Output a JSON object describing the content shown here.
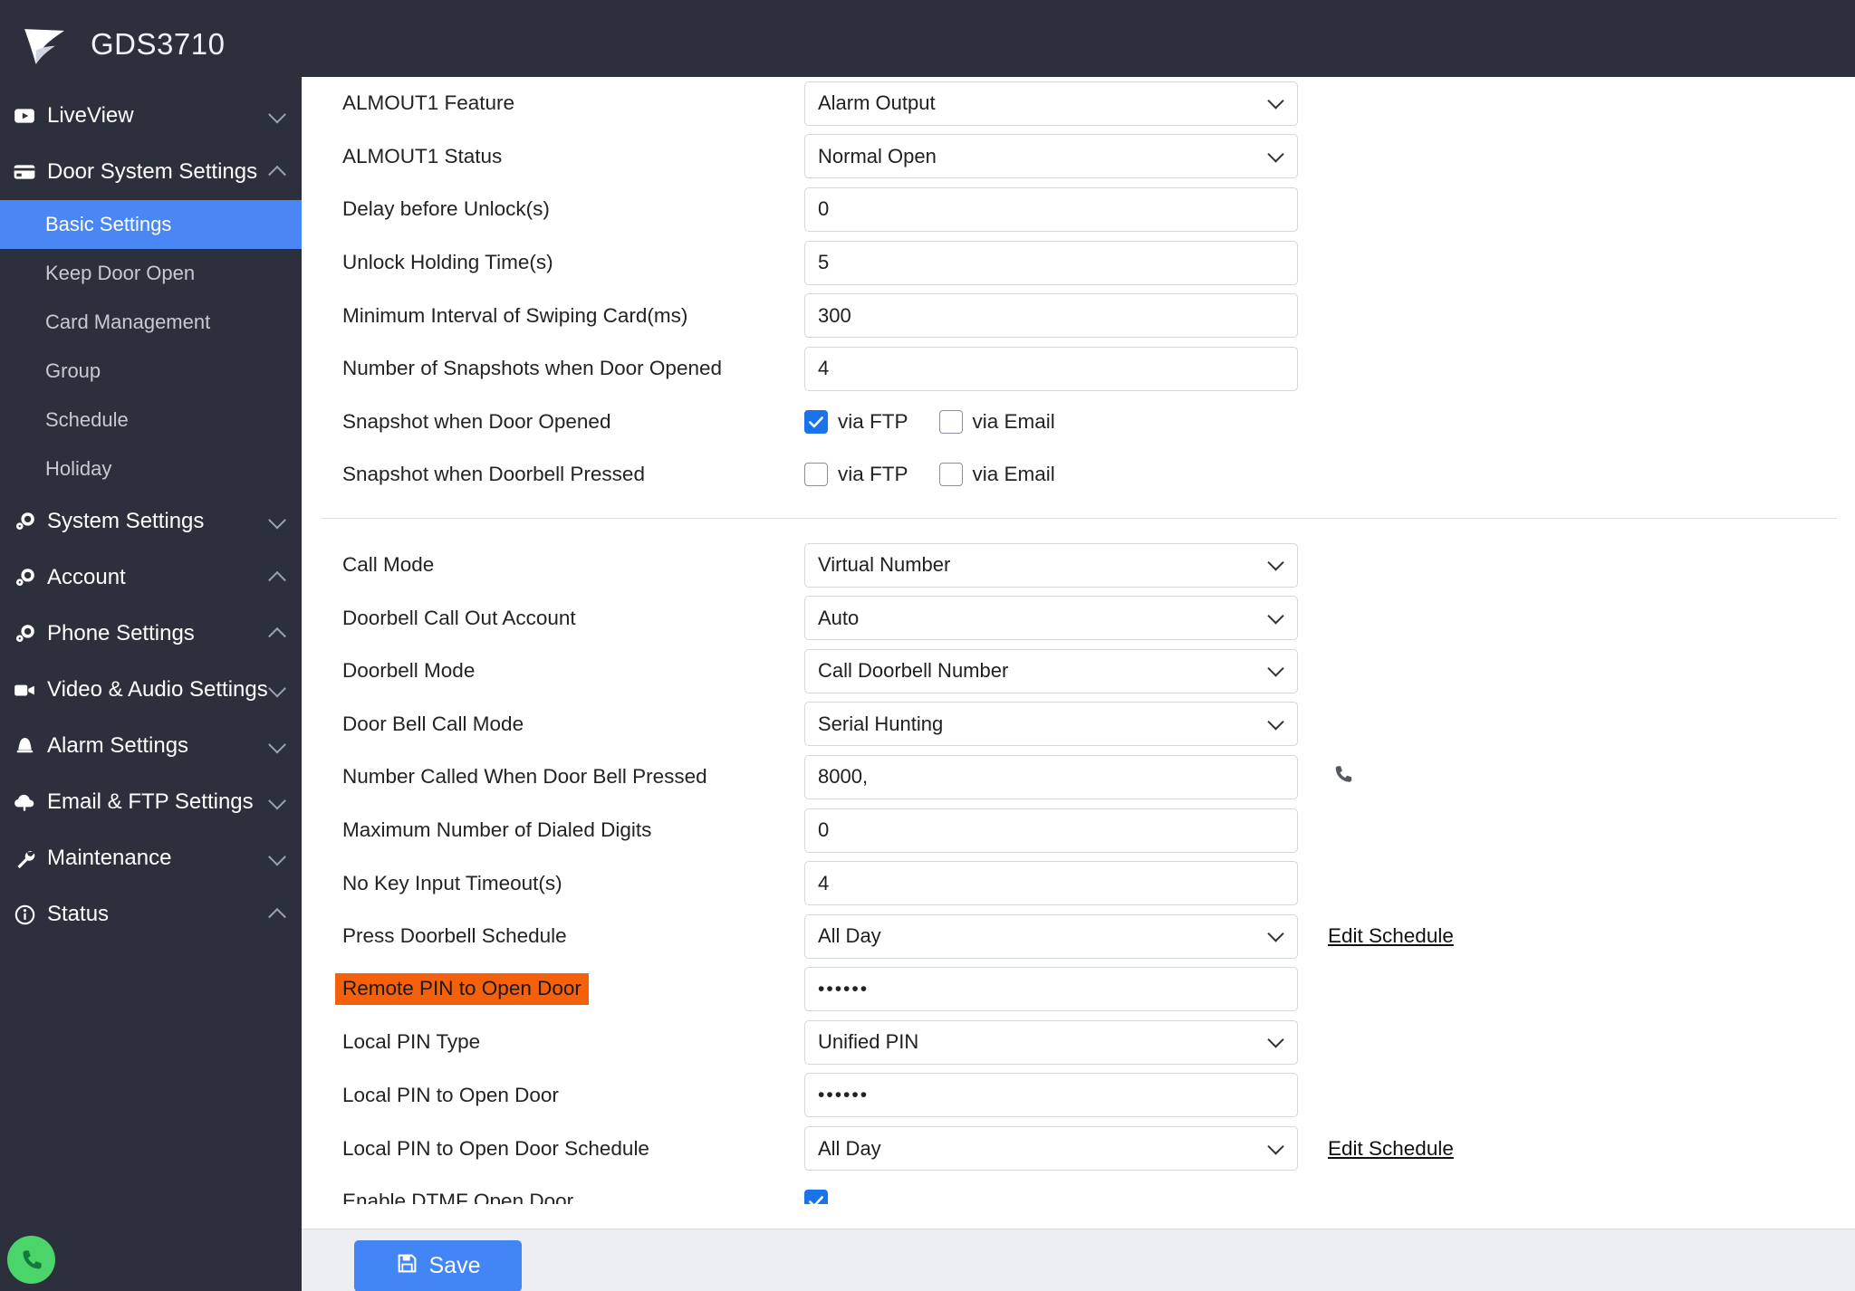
{
  "header": {
    "title": "GDS3710",
    "logo_icon": "grandstream-logo-icon"
  },
  "sidebar": {
    "call_icon": "phone-call-icon",
    "groups": [
      {
        "label": "LiveView",
        "icon": "video-icon",
        "chevron": "down"
      },
      {
        "label": "Door System Settings",
        "icon": "card-reader-icon",
        "chevron": "up",
        "children": [
          {
            "label": "Basic Settings",
            "active": true
          },
          {
            "label": "Keep Door Open",
            "active": false
          },
          {
            "label": "Card Management",
            "active": false
          },
          {
            "label": "Group",
            "active": false
          },
          {
            "label": "Schedule",
            "active": false
          },
          {
            "label": "Holiday",
            "active": false
          }
        ]
      },
      {
        "label": "System Settings",
        "icon": "gear-icon",
        "chevron": "down"
      },
      {
        "label": "Account",
        "icon": "gear-icon",
        "chevron": "up"
      },
      {
        "label": "Phone Settings",
        "icon": "gear-icon",
        "chevron": "up"
      },
      {
        "label": "Video & Audio Settings",
        "icon": "camera-icon",
        "chevron": "down"
      },
      {
        "label": "Alarm Settings",
        "icon": "bell-icon",
        "chevron": "down"
      },
      {
        "label": "Email & FTP Settings",
        "icon": "cloud-upload-icon",
        "chevron": "down"
      },
      {
        "label": "Maintenance",
        "icon": "wrench-icon",
        "chevron": "down"
      },
      {
        "label": "Status",
        "icon": "info-icon",
        "chevron": "up"
      }
    ]
  },
  "colors": {
    "sidebar_bg": "#2b303c",
    "active_item": "#4a87f4",
    "accent_blue": "#4285f4",
    "checkbox_blue": "#1a73e8",
    "highlight_orange": "#f4600c"
  },
  "form": {
    "section1": [
      {
        "label": "ALMOUT1 Feature",
        "type": "select",
        "value": "Alarm Output"
      },
      {
        "label": "ALMOUT1 Status",
        "type": "select",
        "value": "Normal Open"
      },
      {
        "label": "Delay before Unlock(s)",
        "type": "text",
        "value": "0"
      },
      {
        "label": "Unlock Holding Time(s)",
        "type": "text",
        "value": "5"
      },
      {
        "label": "Minimum Interval of Swiping Card(ms)",
        "type": "text",
        "value": "300"
      },
      {
        "label": "Number of Snapshots when Door Opened",
        "type": "text",
        "value": "4"
      },
      {
        "label": "Snapshot when Door Opened",
        "type": "checkboxes",
        "options": [
          {
            "label": "via FTP",
            "checked": true
          },
          {
            "label": "via Email",
            "checked": false
          }
        ]
      },
      {
        "label": "Snapshot when Doorbell Pressed",
        "type": "checkboxes",
        "options": [
          {
            "label": "via FTP",
            "checked": false
          },
          {
            "label": "via Email",
            "checked": false
          }
        ]
      }
    ],
    "section2": [
      {
        "label": "Call Mode",
        "type": "select",
        "value": "Virtual Number"
      },
      {
        "label": "Doorbell Call Out Account",
        "type": "select",
        "value": "Auto"
      },
      {
        "label": "Doorbell Mode",
        "type": "select",
        "value": "Call Doorbell Number"
      },
      {
        "label": "Door Bell Call Mode",
        "type": "select",
        "value": "Serial Hunting"
      },
      {
        "label": "Number Called When Door Bell Pressed",
        "type": "text",
        "value": "8000,",
        "trailing_icon": "phone-icon"
      },
      {
        "label": "Maximum Number of Dialed Digits",
        "type": "text",
        "value": "0"
      },
      {
        "label": "No Key Input Timeout(s)",
        "type": "text",
        "value": "4"
      },
      {
        "label": "Press Doorbell Schedule",
        "type": "select",
        "value": "All Day",
        "link": "Edit Schedule"
      },
      {
        "label": "Remote PIN to Open Door",
        "type": "password",
        "value": "••••••",
        "highlighted": true
      },
      {
        "label": "Local PIN Type",
        "type": "select",
        "value": "Unified PIN"
      },
      {
        "label": "Local PIN to Open Door",
        "type": "password",
        "value": "••••••"
      },
      {
        "label": "Local PIN to Open Door Schedule",
        "type": "select",
        "value": "All Day",
        "link": "Edit Schedule"
      },
      {
        "label": "Enable DTMF Open Door",
        "type": "checkbox",
        "checked": true
      }
    ]
  },
  "footer": {
    "save_label": "Save",
    "save_icon": "floppy-disk-icon"
  }
}
